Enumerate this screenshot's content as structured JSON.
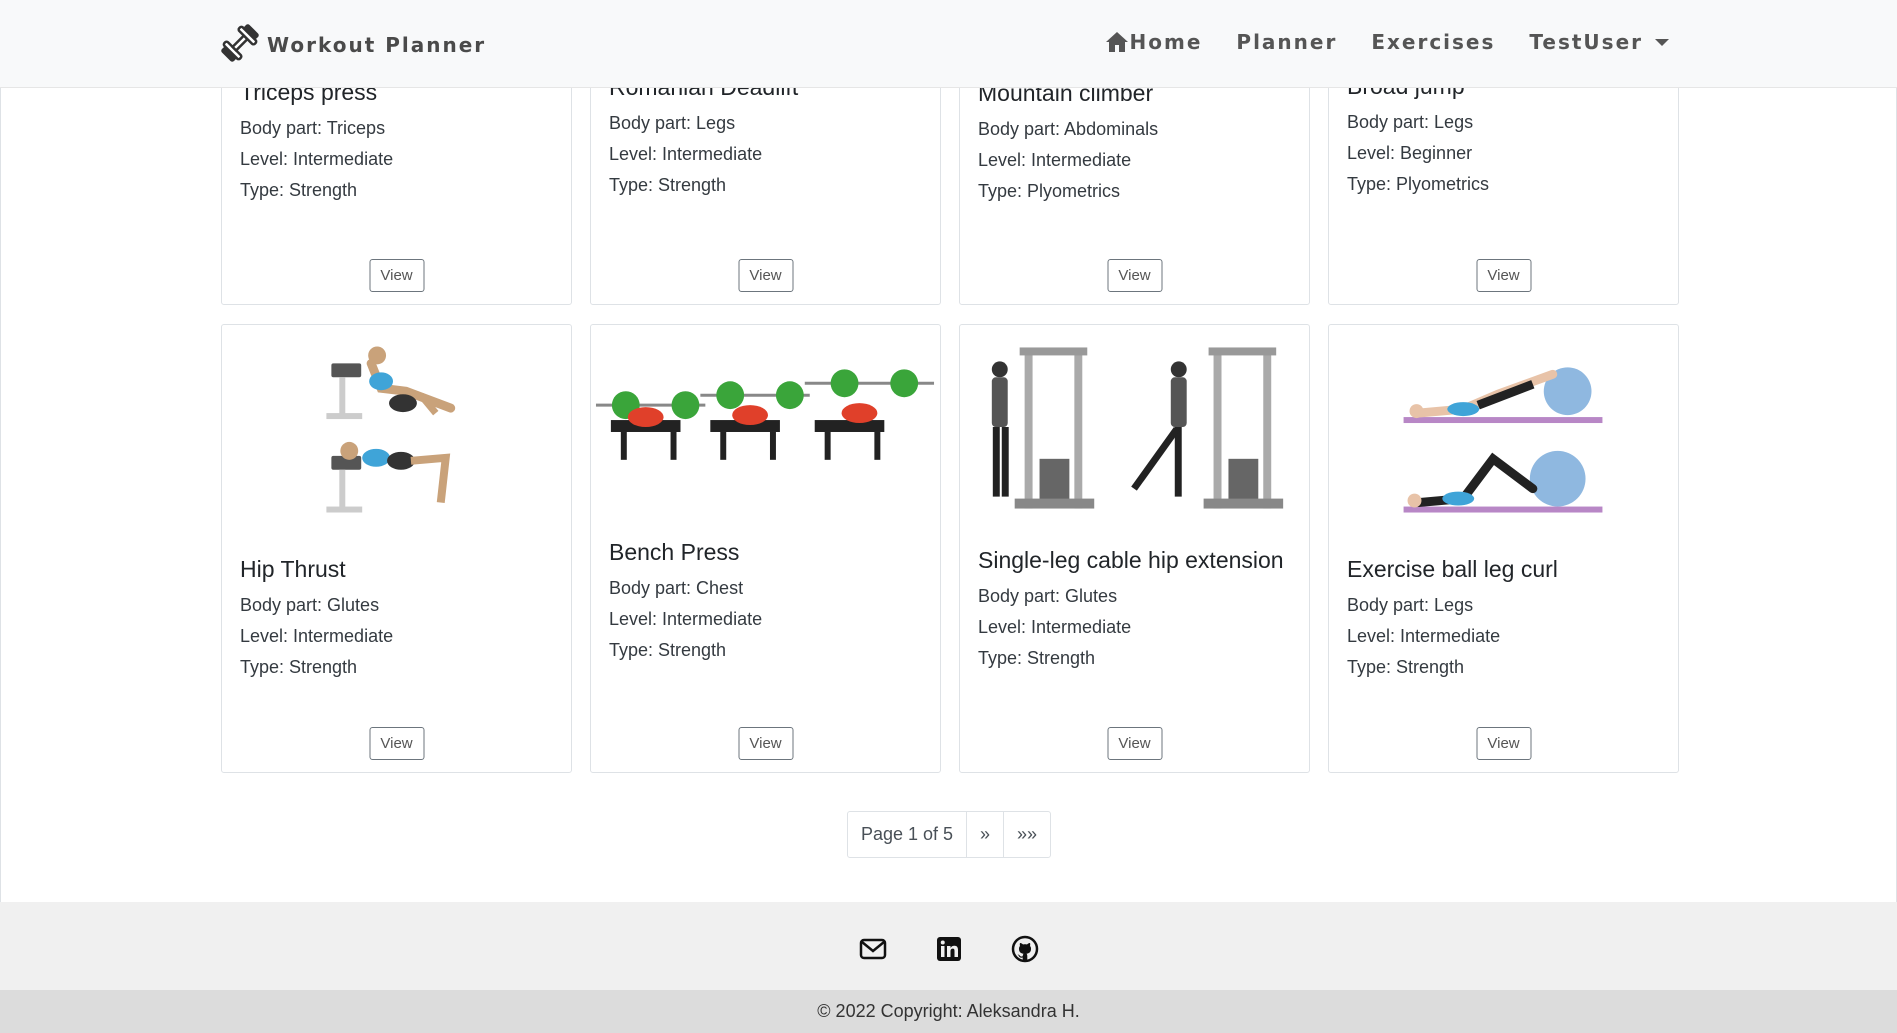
{
  "navbar": {
    "brand": "Workout Planner",
    "links": [
      "Home",
      "Planner",
      "Exercises"
    ],
    "user": "TestUser"
  },
  "cards_top": [
    {
      "title": "Triceps press",
      "body_part": "Body part: Triceps",
      "level": "Level: Intermediate",
      "type": "Type: Strength",
      "button": "View"
    },
    {
      "title": "Romanian Deadlift",
      "body_part": "Body part: Legs",
      "level": "Level: Intermediate",
      "type": "Type: Strength",
      "button": "View"
    },
    {
      "title": "Mountain climber",
      "body_part": "Body part: Abdominals",
      "level": "Level: Intermediate",
      "type": "Type: Plyometrics",
      "button": "View"
    },
    {
      "title": "Broad jump",
      "body_part": "Body part: Legs",
      "level": "Level: Beginner",
      "type": "Type: Plyometrics",
      "button": "View"
    }
  ],
  "cards_bottom": [
    {
      "title": "Hip Thrust",
      "body_part": "Body part: Glutes",
      "level": "Level: Intermediate",
      "type": "Type: Strength",
      "button": "View"
    },
    {
      "title": "Bench Press",
      "body_part": "Body part: Chest",
      "level": "Level: Intermediate",
      "type": "Type: Strength",
      "button": "View"
    },
    {
      "title": "Single-leg cable hip extension",
      "body_part": "Body part: Glutes",
      "level": "Level: Intermediate",
      "type": "Type: Strength",
      "button": "View"
    },
    {
      "title": "Exercise ball leg curl",
      "body_part": "Body part: Legs",
      "level": "Level: Intermediate",
      "type": "Type: Strength",
      "button": "View"
    }
  ],
  "pagination": {
    "label": "Page 1 of 5",
    "next": "»",
    "last": "»»"
  },
  "footer": {
    "icons": [
      "envelope-icon",
      "linkedin-icon",
      "github-icon"
    ],
    "copyright": "© 2022 Copyright: Aleksandra H."
  },
  "colors": {
    "navbar_bg": "#f8f9fa",
    "footer_bg": "#f0f0f0",
    "copyright_bg": "#dcdcdc",
    "text": "#212529"
  }
}
